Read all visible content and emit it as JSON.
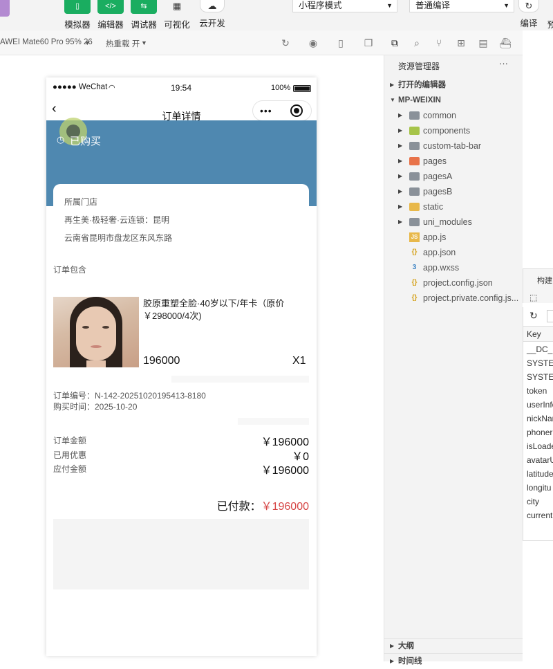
{
  "toolbar": {
    "buttons": [
      {
        "label": "模拟器",
        "icon": "phone-icon"
      },
      {
        "label": "编辑器",
        "icon": "code-icon"
      },
      {
        "label": "调试器",
        "icon": "debug-icon"
      },
      {
        "label": "可视化",
        "icon": "layout-icon"
      },
      {
        "label": "云开发",
        "icon": "cloud-icon"
      }
    ],
    "mode_select": "小程序模式",
    "compile_select": "普通编译",
    "compile_label": "编译",
    "preview_label": "预"
  },
  "devbar": {
    "device": "AWEI Mate60 Pro 95% 26",
    "hot_reload": "热重载 开"
  },
  "phone": {
    "status": {
      "carrier": "●●●●● WeChat",
      "time": "19:54",
      "battery": "100%"
    },
    "nav_title": "订单详情",
    "banner_status": "已购买",
    "store": {
      "heading": "所属门店",
      "name": "再生美·极轻奢·云连锁：昆明",
      "address": "云南省昆明市盘龙区东风东路"
    },
    "contains_label": "订单包含",
    "product": {
      "title": "胶原重塑全脸·40岁以下/年卡（原价￥298000/4次)",
      "price": "196000",
      "qty": "X1"
    },
    "order_no": "订单编号：N-142-20251020195413-8180",
    "buy_time": "购买时间：2025-10-20",
    "amounts": [
      {
        "label": "订单金额",
        "value": "￥196000"
      },
      {
        "label": "已用优惠",
        "value": "￥0"
      },
      {
        "label": "应付金额",
        "value": "￥196000"
      }
    ],
    "paid_label": "已付款：",
    "paid_value": "￥196000"
  },
  "explorer": {
    "title": "资源管理器",
    "more": "···",
    "open_editors": "打开的编辑器",
    "project": "MP-WEIXIN",
    "items": [
      {
        "name": "common",
        "kind": "folder",
        "color": "#8a9199"
      },
      {
        "name": "components",
        "kind": "folder",
        "color": "#a6c44a"
      },
      {
        "name": "custom-tab-bar",
        "kind": "folder",
        "color": "#8a9199"
      },
      {
        "name": "pages",
        "kind": "folder",
        "color": "#e8734a"
      },
      {
        "name": "pagesA",
        "kind": "folder",
        "color": "#8a9199"
      },
      {
        "name": "pagesB",
        "kind": "folder",
        "color": "#8a9199"
      },
      {
        "name": "static",
        "kind": "folder",
        "color": "#e8b84a"
      },
      {
        "name": "uni_modules",
        "kind": "folder",
        "color": "#8a9199"
      },
      {
        "name": "app.js",
        "kind": "js",
        "color": "#e8b84a"
      },
      {
        "name": "app.json",
        "kind": "json",
        "color": "#d4a017"
      },
      {
        "name": "app.wxss",
        "kind": "css",
        "color": "#3b82c4"
      },
      {
        "name": "project.config.json",
        "kind": "json",
        "color": "#d4a017"
      },
      {
        "name": "project.private.config.js...",
        "kind": "json",
        "color": "#d4a017"
      }
    ],
    "outline": "大纲",
    "timeline": "时间线"
  },
  "storage": {
    "tab": "构建",
    "key_header": "Key",
    "keys": [
      "__DC_S",
      "SYSTEM",
      "SYSTEM",
      "token",
      "userInfo",
      "nickNar",
      "phoner",
      "isLoade",
      "avatarU",
      "latitude",
      "longitu",
      "city",
      "current"
    ]
  }
}
